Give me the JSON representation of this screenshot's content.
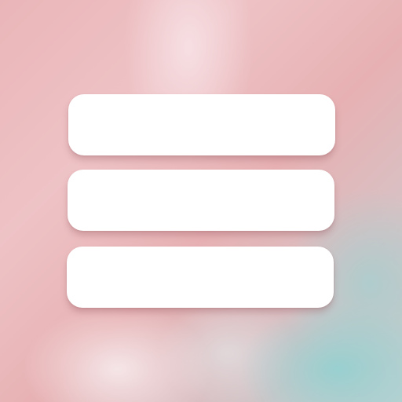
{
  "icon": {
    "name": "hamburger-menu-icon",
    "bar_count": 3,
    "bar_color": "#ffffff",
    "background_colors": [
      "#eab5b8",
      "#eec3c6",
      "#b8d2d2",
      "#96d0d0"
    ]
  }
}
